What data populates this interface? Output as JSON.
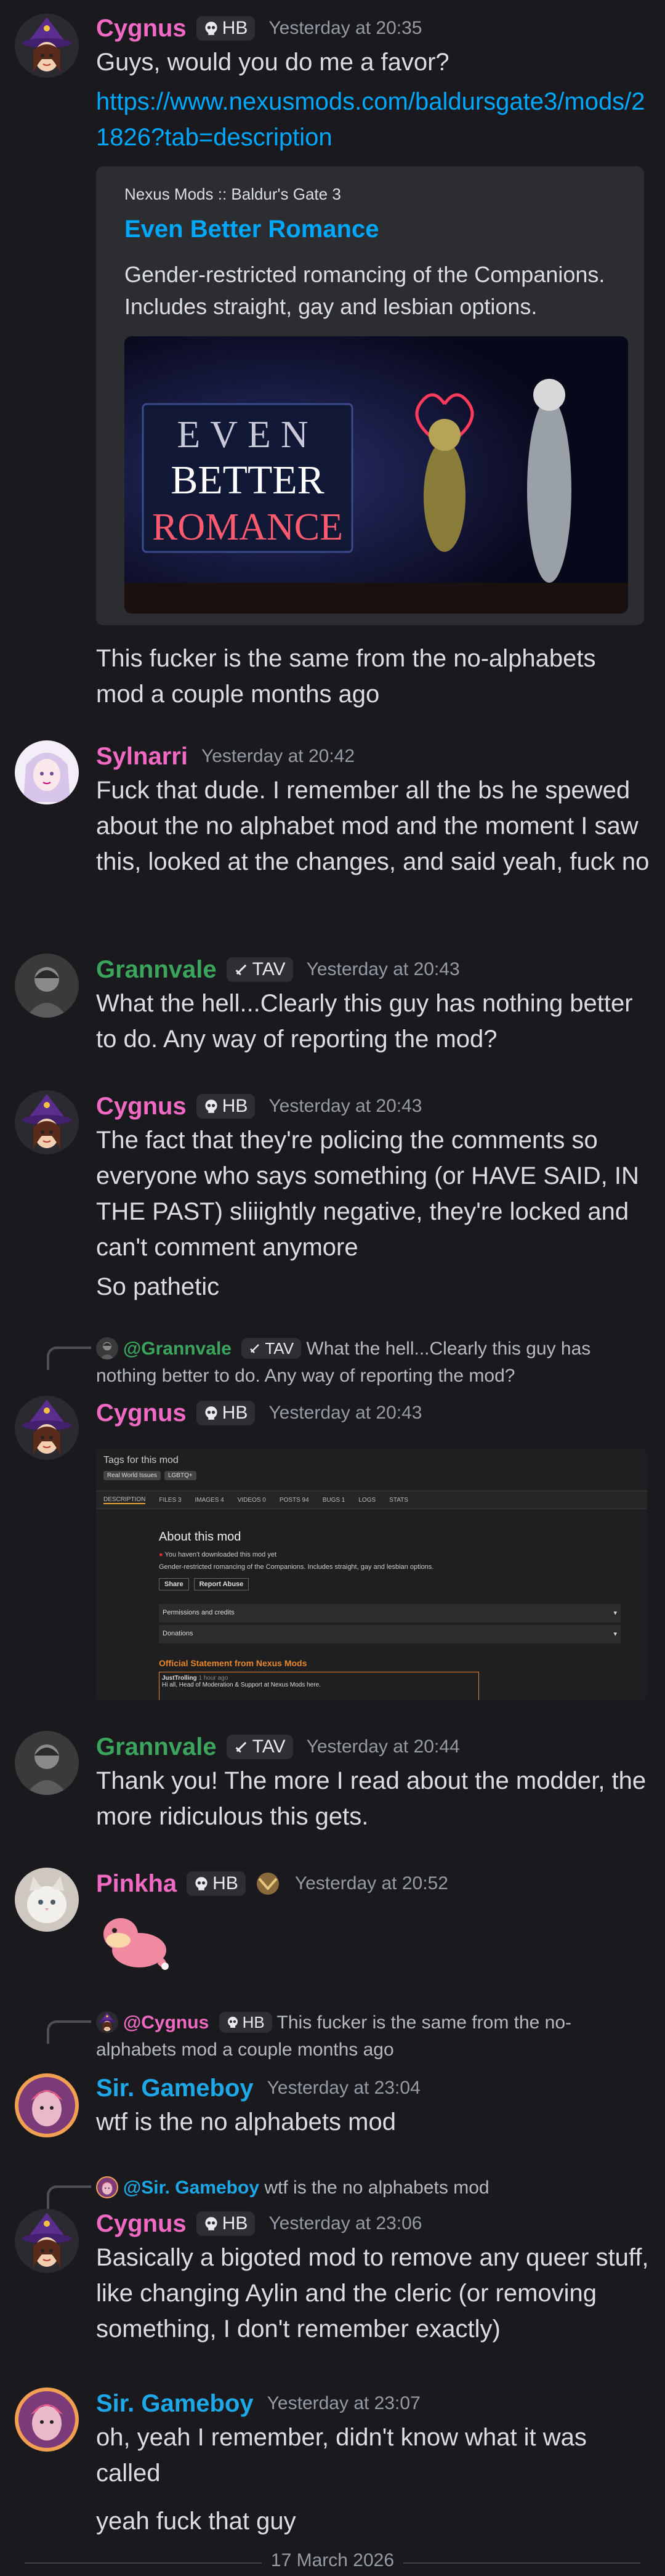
{
  "colors": {
    "cygnus": "#f06ac3",
    "sylnarri": "#f06ac3",
    "grannvale": "#3ba55d",
    "pinkha": "#f06ac3",
    "sirgameboy": "#1ea8e8",
    "link": "#00a8fc"
  },
  "messages": {
    "m1": {
      "author": "Cygnus",
      "badge": "HB",
      "time": "Yesterday at 20:35",
      "text": "Guys, would you do me a favor?",
      "link": "https://www.nexusmods.com/baldursgate3/mods/21826?tab=description",
      "embed": {
        "provider": "Nexus Mods :: Baldur's Gate 3",
        "title": "Even Better Romance",
        "description": "Gender-restricted romancing of the Companions. Includes straight, gay and lesbian options.",
        "image_text": [
          "EVEN",
          "BETTER",
          "ROMANCE"
        ]
      },
      "followup": "This fucker is the same from the no-alphabets mod a couple months ago"
    },
    "m2": {
      "author": "Sylnarri",
      "time": "Yesterday at 20:42",
      "text": "Fuck that dude. I remember all the bs he spewed about the no alphabet mod and the moment I saw this, looked at the changes, and said yeah, fuck no"
    },
    "m3": {
      "author": "Grannvale",
      "badge": "TAV",
      "time": "Yesterday at 20:43",
      "text": "What the hell...Clearly this guy has nothing better to do. Any way of reporting the mod?"
    },
    "m4": {
      "author": "Cygnus",
      "badge": "HB",
      "time": "Yesterday at 20:43",
      "text": "The fact that they're policing the comments so everyone who says something (or HAVE SAID, IN THE PAST) sliiightly negative, they're locked and can't comment anymore",
      "followup": "So pathetic"
    },
    "m5": {
      "reply_name": "@Grannvale",
      "reply_badge": "TAV",
      "reply_text": "What the hell...Clearly this guy has nothing better to do. Any way of reporting the mod?",
      "author": "Cygnus",
      "badge": "HB",
      "time": "Yesterday at 20:43",
      "screenshot": {
        "tags": "Tags for this mod",
        "tag1": "Real World Issues",
        "tag2": "LGBTQ+",
        "tabs": [
          "DESCRIPTION",
          "FILES 3",
          "IMAGES 4",
          "VIDEOS 0",
          "POSTS 94",
          "BUGS 1",
          "LOGS",
          "STATS"
        ],
        "about": "About this mod",
        "notice": "You haven't downloaded this mod yet",
        "desc": "Gender-restricted romancing of the Companions. Includes straight, gay and lesbian options.",
        "share": "Share",
        "report": "Report Abuse",
        "perm": "Permissions and credits",
        "donations": "Donations",
        "official": "Official Statement from Nexus Mods",
        "poster": "JustTrolling",
        "post_time": "1 hour ago",
        "post_text": "Hi all, Head of Moderation & Support at Nexus Mods here."
      }
    },
    "m6": {
      "author": "Grannvale",
      "badge": "TAV",
      "time": "Yesterday at 20:44",
      "text": "Thank you! The more I read about the modder, the more ridiculous this gets."
    },
    "m7": {
      "author": "Pinkha",
      "badge": "HB",
      "time": "Yesterday at 20:52"
    },
    "m8": {
      "reply_name": "@Cygnus",
      "reply_badge": "HB",
      "reply_text": "This fucker is the same from the no-alphabets mod a couple months ago",
      "author": "Sir. Gameboy",
      "time": "Yesterday at 23:04",
      "text": "wtf is the no alphabets mod"
    },
    "m9": {
      "reply_name": "@Sir. Gameboy",
      "reply_text": "wtf is the no alphabets mod",
      "author": "Cygnus",
      "badge": "HB",
      "time": "Yesterday at 23:06",
      "text": "Basically a bigoted mod to remove any queer stuff, like changing Aylin and the cleric (or removing something, I don't remember exactly)"
    },
    "m10": {
      "author": "Sir. Gameboy",
      "time": "Yesterday at 23:07",
      "text": "oh, yeah I remember, didn't know what it was called",
      "followup": "yeah fuck that guy"
    }
  },
  "date_divider": "17 March 2026"
}
